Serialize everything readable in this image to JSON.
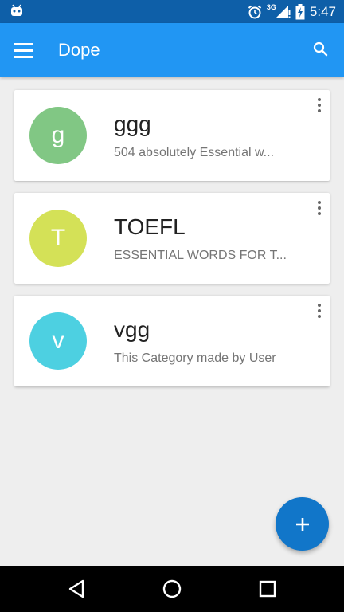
{
  "status_bar": {
    "time": "5:47",
    "network_label": "3G",
    "icons": [
      "android-icon",
      "alarm-icon",
      "signal-icon",
      "battery-charging-icon"
    ]
  },
  "app_bar": {
    "title": "Dope",
    "menu_icon": "hamburger-menu-icon",
    "search_icon": "search-icon"
  },
  "categories": [
    {
      "initial": "g",
      "title": "ggg",
      "subtitle": "504 absolutely Essential w...",
      "color": "#81c784"
    },
    {
      "initial": "T",
      "title": "TOEFL",
      "subtitle": "ESSENTIAL WORDS FOR T...",
      "color": "#d4e157"
    },
    {
      "initial": "v",
      "title": "vgg",
      "subtitle": "This Category made by User",
      "color": "#4dd0e1"
    }
  ],
  "fab": {
    "icon": "add-icon",
    "label": "+"
  },
  "nav_bar": {
    "icons": [
      "back-icon",
      "home-icon",
      "recents-icon"
    ]
  },
  "colors": {
    "status_bar": "#0e5fa8",
    "app_bar": "#2196f3",
    "fab": "#1176c9",
    "background": "#eeeeee"
  }
}
